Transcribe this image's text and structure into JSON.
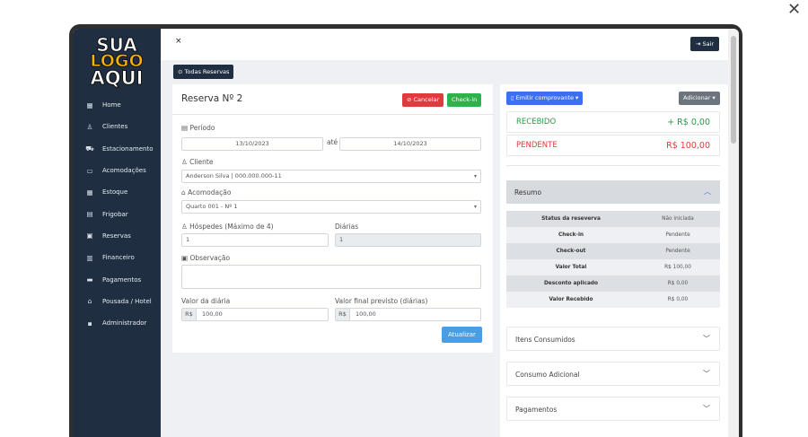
{
  "overlay": {
    "close_icon": "close-icon"
  },
  "logo": {
    "line1": "SUA",
    "line2": "LOGO",
    "line3": "AQUI"
  },
  "sidebar": {
    "items": [
      {
        "icon": "grid-icon",
        "glyph": "▦",
        "label": "Home"
      },
      {
        "icon": "user-icon",
        "glyph": "♙",
        "label": "Clientes"
      },
      {
        "icon": "car-icon",
        "glyph": "⛟",
        "label": "Estacionamento"
      },
      {
        "icon": "bed-icon",
        "glyph": "▭",
        "label": "Acomodações"
      },
      {
        "icon": "grid-icon",
        "glyph": "▦",
        "label": "Estoque"
      },
      {
        "icon": "fridge-icon",
        "glyph": "▤",
        "label": "Frigobar"
      },
      {
        "icon": "calendar-icon",
        "glyph": "▣",
        "label": "Reservas"
      },
      {
        "icon": "document-icon",
        "glyph": "▥",
        "label": "Financeiro"
      },
      {
        "icon": "wallet-icon",
        "glyph": "▬",
        "label": "Pagamentos"
      },
      {
        "icon": "home-icon",
        "glyph": "⌂",
        "label": "Pousada / Hotel"
      },
      {
        "icon": "lock-icon",
        "glyph": "▪",
        "label": "Administrador"
      }
    ]
  },
  "topbar": {
    "close": "×",
    "logout": "⇥ Sair"
  },
  "todas_reservas": "⊙ Todas Reservas",
  "reserva": {
    "title": "Reserva Nº 2",
    "cancel": "⊘ Cancelar",
    "checkin": "Check-in",
    "periodo_label": "▤ Período",
    "data_inicio": "13/10/2023",
    "ate": "até",
    "data_fim": "14/10/2023",
    "cliente_label": "♙ Cliente",
    "cliente_value": "Anderson Silva | 000.000.000-11",
    "acomodacao_label": "⌂ Acomodação",
    "acomodacao_value": "Quarto 001 - Nº 1",
    "hospedes_label": "♙ Hóspedes (Máximo de 4)",
    "hospedes_value": "1",
    "diarias_label": "Diárias",
    "diarias_value": "1",
    "observacao_label": "▣ Observação",
    "observacao_value": "",
    "valor_diaria_label": "Valor da diária",
    "valor_diaria_prefix": "R$",
    "valor_diaria_value": "100,00",
    "valor_final_label": "Valor final previsto (diárias)",
    "valor_final_prefix": "R$",
    "valor_final_value": "100,00",
    "atualizar": "Atualizar"
  },
  "right": {
    "emitir": "▯ Emitir comprovante ▾",
    "adicionar": "Adicionar ▾",
    "recebido_label": "RECEBIDO",
    "recebido_value": "+ R$ 0,00",
    "pendente_label": "PENDENTE",
    "pendente_value": "R$ 100,00",
    "resumo_title": "Resumo",
    "resumo": [
      {
        "k": "Status da reseverva",
        "v": "Não iniciada"
      },
      {
        "k": "Check-in",
        "v": "Pendente"
      },
      {
        "k": "Check-out",
        "v": "Pendente"
      },
      {
        "k": "Valor Total",
        "v": "R$ 100,00"
      },
      {
        "k": "Desconto aplicado",
        "v": "R$ 0,00"
      },
      {
        "k": "Valor Recebido",
        "v": "R$ 0,00"
      }
    ],
    "accordions": [
      {
        "label": "Itens Consumidos"
      },
      {
        "label": "Consumo Adicional"
      },
      {
        "label": "Pagamentos"
      }
    ]
  },
  "colors": {
    "sidebar": "#1f2e40",
    "cancel": "#e0393e",
    "checkin": "#2db34a",
    "emitir": "#3d6ff2",
    "atualizar": "#4a9de0",
    "recebido": "#2a9a46",
    "pendente": "#e03a3a"
  }
}
